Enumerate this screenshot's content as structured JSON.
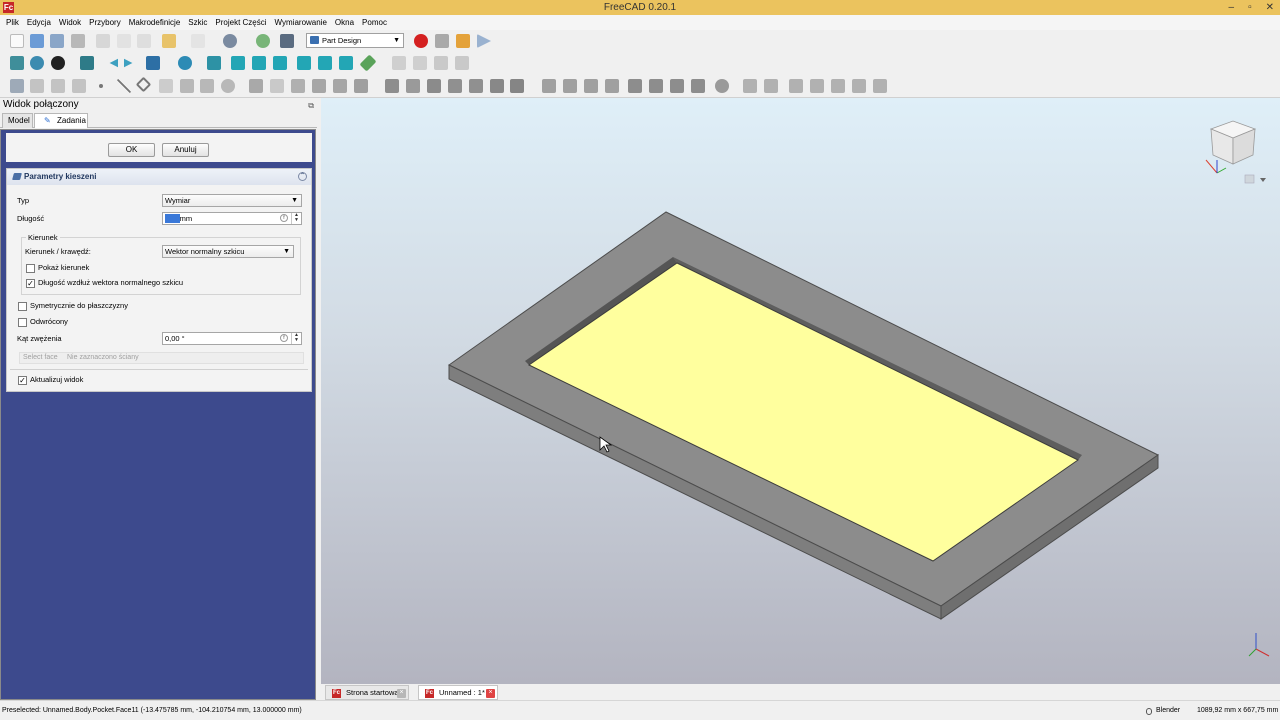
{
  "window": {
    "title": "FreeCAD 0.20.1",
    "app_icon": "Fc",
    "min": "–",
    "max": "▫",
    "close": "✕"
  },
  "menu": [
    "Plik",
    "Edycja",
    "Widok",
    "Przybory",
    "Makrodefinicje",
    "Szkic",
    "Projekt Części",
    "Wymiarowanie",
    "Okna",
    "Pomoc"
  ],
  "toolbar": {
    "workbench": "Part Design"
  },
  "left_panel": {
    "title": "Widok połączony",
    "tabs": {
      "model": "Model",
      "tasks": "Zadania"
    },
    "buttons": {
      "ok": "OK",
      "cancel": "Anuluj"
    },
    "section_title": "Parametry kieszeni",
    "type_label": "Typ",
    "type_value": "Wymiar",
    "length_label": "Długość",
    "length_value": "2,00",
    "length_unit": "mm",
    "direction_group": "Kierunek",
    "direction_edge_label": "Kierunek / krawędź:",
    "direction_edge_value": "Wektor normalny szkicu",
    "show_direction": {
      "label": "Pokaż kierunek",
      "checked": false
    },
    "length_along_normal": {
      "label": "Długość wzdłuż wektora normalnego szkicu",
      "checked": true
    },
    "symmetric": {
      "label": "Symetrycznie do płaszczyzny",
      "checked": false
    },
    "reversed": {
      "label": "Odwrócony",
      "checked": false
    },
    "taper_label": "Kąt zwężenia",
    "taper_value": "0,00 °",
    "select_face": "Select face",
    "no_face": "Nie zaznaczono ściany",
    "update_view": {
      "label": "Aktualizuj widok",
      "checked": true
    }
  },
  "doc_tabs": [
    {
      "label": "Strona startowa",
      "active": false
    },
    {
      "label": "Unnamed : 1*",
      "active": true
    }
  ],
  "status": {
    "message": "Preselected: Unnamed.Body.Pocket.Face11 (-13.475785 mm, -104.210754 mm, 13.000000 mm)",
    "navigation": "Blender",
    "dimensions": "1089,92 mm x 667,75 mm"
  },
  "colors": {
    "titlebar": "#ebc35e",
    "task_panel_bg": "#3d4a8d",
    "plate": "#8c8c8c",
    "pocket_face": "#ffff9e"
  }
}
